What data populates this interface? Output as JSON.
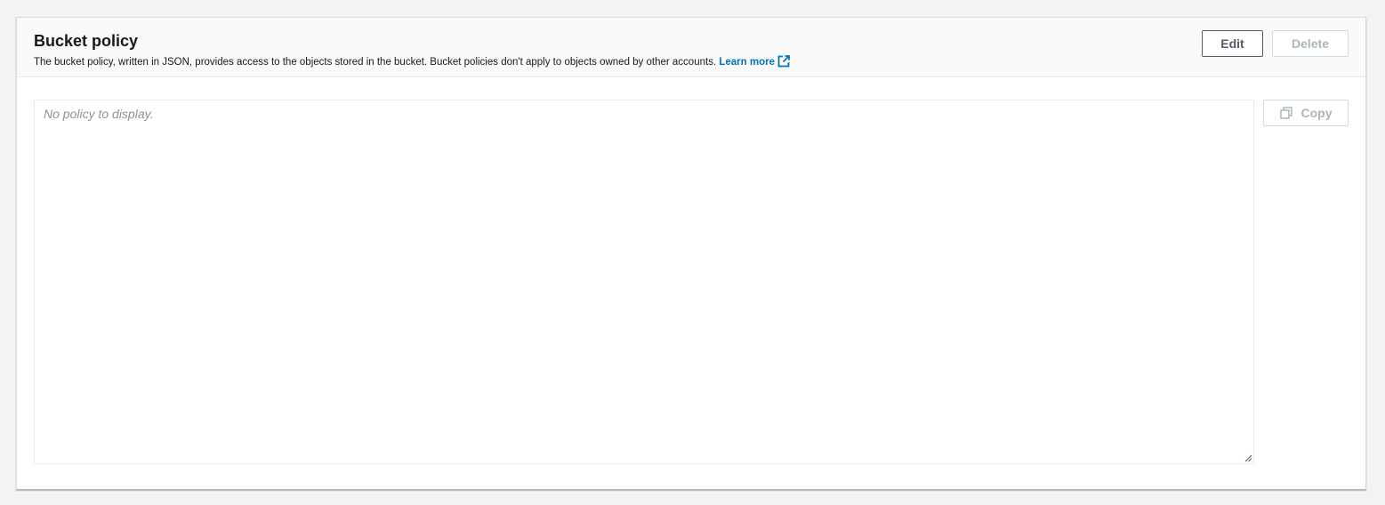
{
  "panel": {
    "title": "Bucket policy",
    "description": "The bucket policy, written in JSON, provides access to the objects stored in the bucket. Bucket policies don't apply to objects owned by other accounts.",
    "learn_more_label": "Learn more",
    "external_link_icon": "external-link-icon"
  },
  "actions": {
    "edit_label": "Edit",
    "delete_label": "Delete",
    "copy_label": "Copy",
    "copy_icon": "copy-icon"
  },
  "policy": {
    "placeholder": "No policy to display."
  },
  "colors": {
    "link": "#0073bb",
    "text": "#16191f",
    "disabled": "#aab7b8",
    "placeholder": "#879596"
  }
}
